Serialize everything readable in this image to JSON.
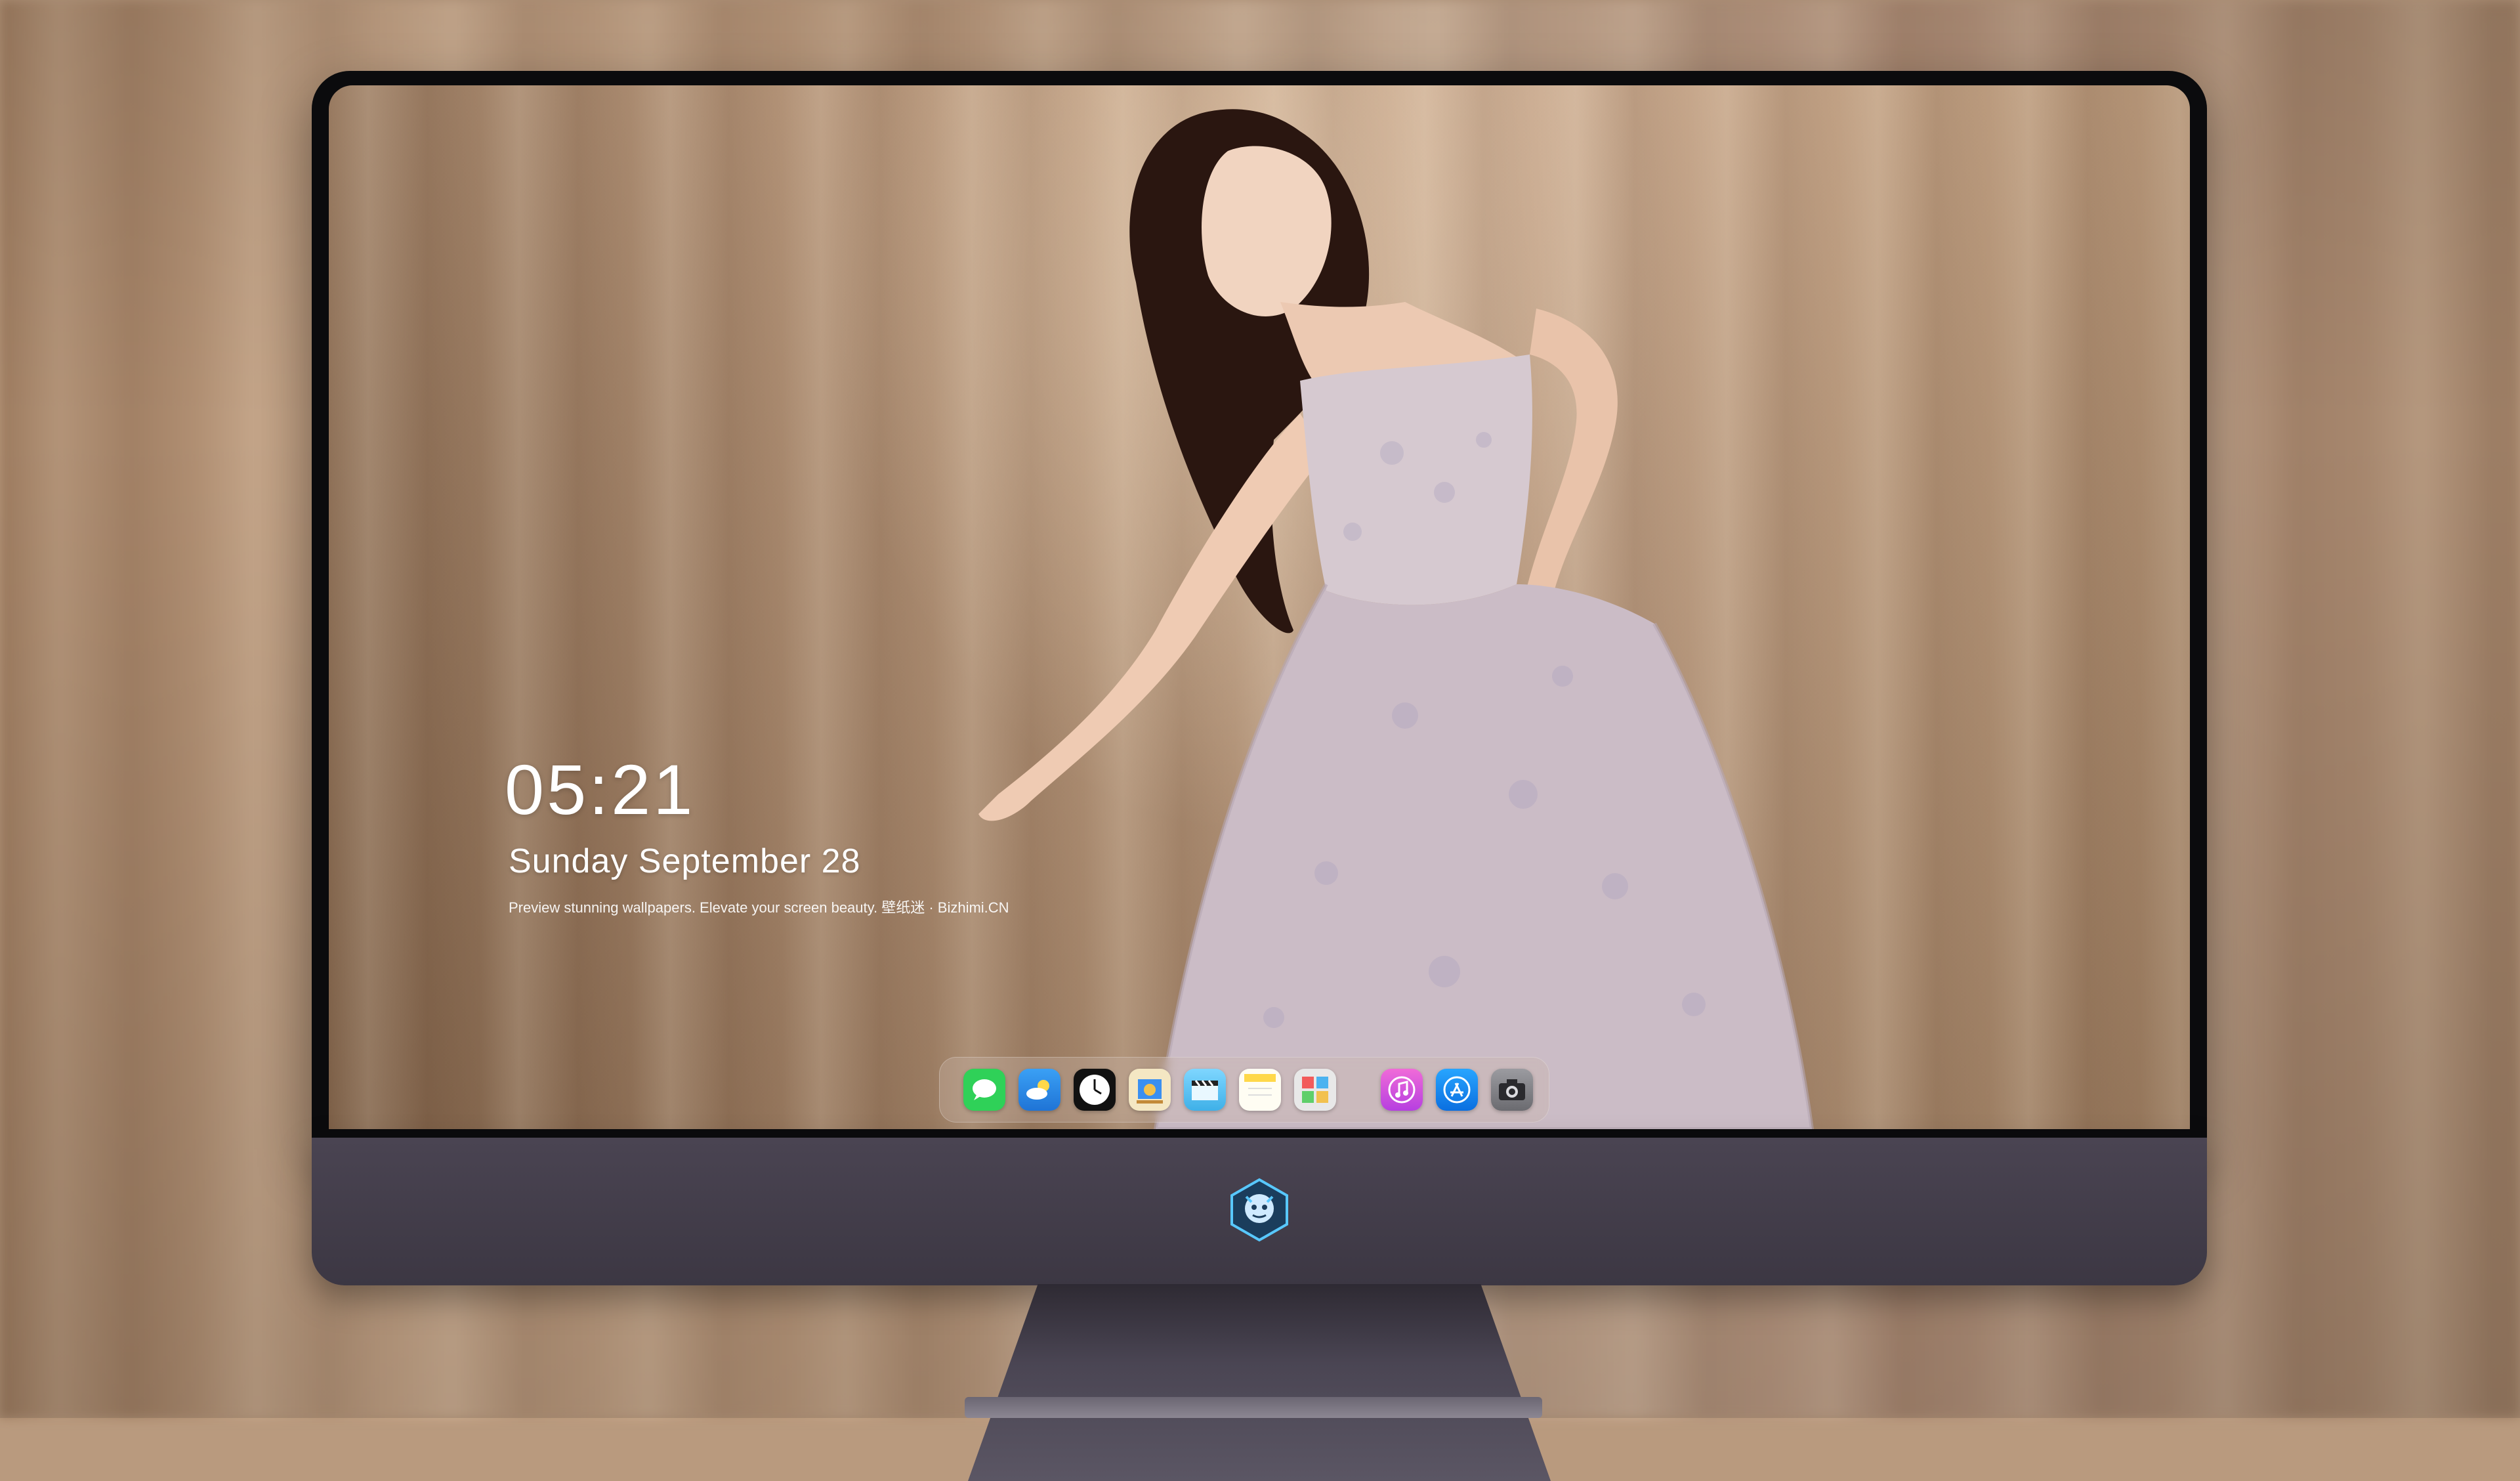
{
  "lock_screen": {
    "time": "05:21",
    "date": "Sunday September  28",
    "caption": "Preview stunning wallpapers. Elevate your screen beauty. 壁纸迷 · Bizhimi.CN"
  },
  "dock": {
    "apps": [
      {
        "icon": "messages-icon",
        "color": "#2fd158"
      },
      {
        "icon": "weather-icon",
        "color": "#3a9bf0"
      },
      {
        "icon": "clock-icon",
        "color": "#111111"
      },
      {
        "icon": "preview-icon",
        "color": "#f2c14e"
      },
      {
        "icon": "clips-icon",
        "color": "#5ac8fa"
      },
      {
        "icon": "notes-icon",
        "color": "#ffd84a"
      },
      {
        "icon": "photo-booth-icon",
        "color": "#e8e8e8"
      }
    ],
    "apps_right": [
      {
        "icon": "itunes-icon",
        "color": "#e84ee0"
      },
      {
        "icon": "app-store-icon",
        "color": "#1d8ef5"
      },
      {
        "icon": "camera-icon",
        "color": "#8a8a8e"
      }
    ]
  },
  "monitor": {
    "logo": "dragon-logo-icon"
  }
}
